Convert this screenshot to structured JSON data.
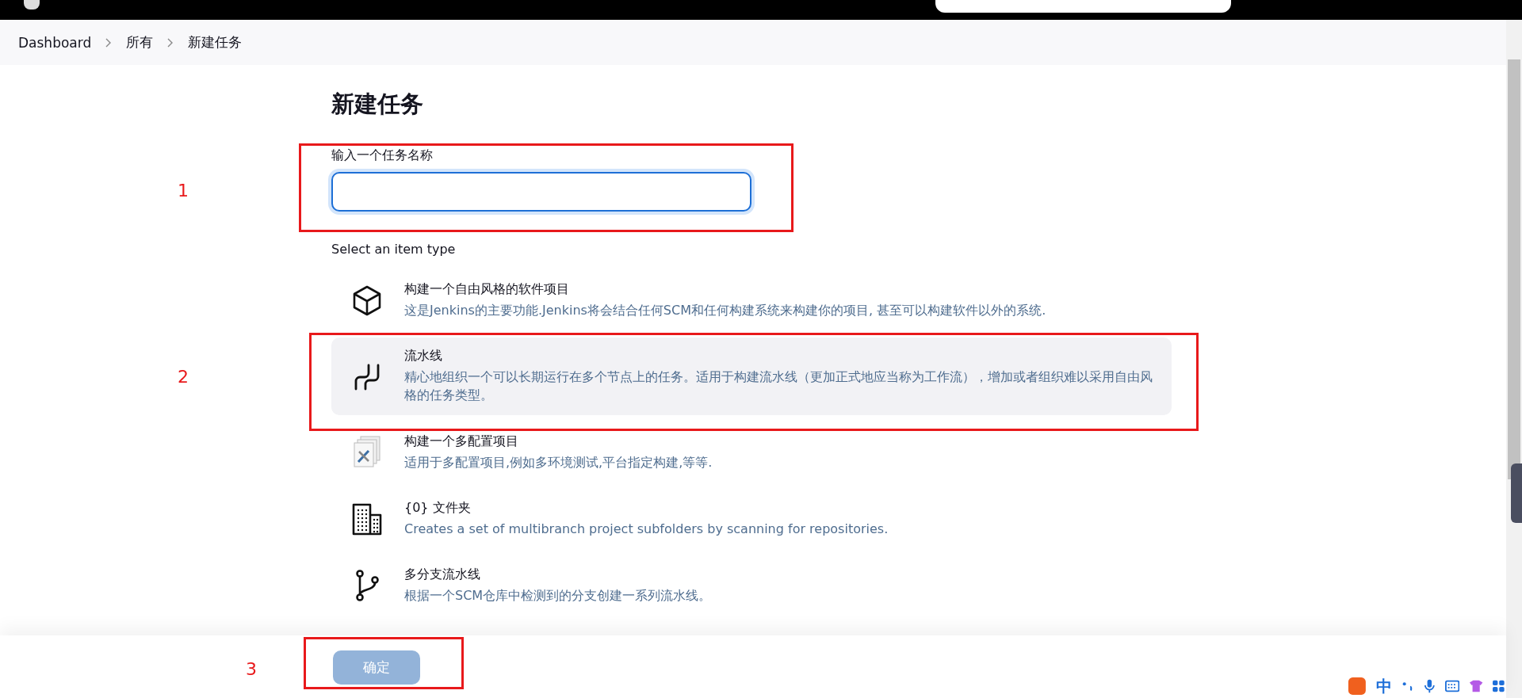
{
  "breadcrumbs": [
    {
      "label": "Dashboard"
    },
    {
      "label": "所有"
    },
    {
      "label": "新建任务"
    }
  ],
  "title": "新建任务",
  "name_field": {
    "label": "输入一个任务名称"
  },
  "item_type_label": "Select an item type",
  "item_types": [
    {
      "kind": "box",
      "name": "构建一个自由风格的软件项目",
      "description": "这是Jenkins的主要功能.Jenkins将会结合任何SCM和任何构建系统来构建你的项目, 甚至可以构建软件以外的系统.",
      "selected": false
    },
    {
      "kind": "pipeline",
      "name": "流水线",
      "description": "精心地组织一个可以长期运行在多个节点上的任务。适用于构建流水线（更加正式地应当称为工作流），增加或者组织难以采用自由风格的任务类型。",
      "selected": true
    },
    {
      "kind": "config",
      "name": "构建一个多配置项目",
      "description": "适用于多配置项目,例如多环境测试,平台指定构建,等等.",
      "selected": false
    },
    {
      "kind": "building",
      "name": "{0} 文件夹",
      "description": "Creates a set of multibranch project subfolders by scanning for repositories.",
      "selected": false
    },
    {
      "kind": "branch",
      "name": "多分支流水线",
      "description": "根据一个SCM仓库中检测到的分支创建一系列流水线。",
      "selected": false
    }
  ],
  "ok_button": {
    "label": "确定",
    "disabled": true
  },
  "annotations": [
    {
      "number": "1"
    },
    {
      "number": "2"
    },
    {
      "number": "3"
    }
  ],
  "ime_toolbar": {
    "mode": "中"
  }
}
